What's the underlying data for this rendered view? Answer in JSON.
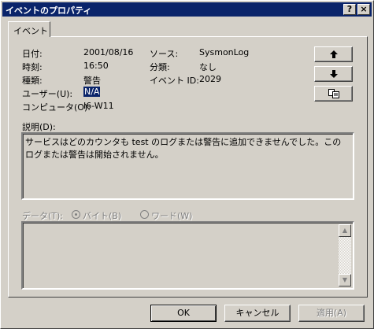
{
  "window": {
    "title": "イベントのプロパティ",
    "help_label": "?",
    "close_label": "×"
  },
  "tab": {
    "label": "イベント"
  },
  "fields": {
    "date_label": "日付:",
    "date": "2001/08/16",
    "time_label": "時刻:",
    "time": "16:50",
    "type_label": "種類:",
    "type": "警告",
    "user_label": "ユーザー(U):",
    "user": "N/A",
    "computer_label": "コンピュータ(O):",
    "computer": "I6-W11",
    "source_label": "ソース:",
    "source": "SysmonLog",
    "category_label": "分類:",
    "category": "なし",
    "event_id_label": "イベント ID:",
    "event_id": "2029"
  },
  "nav": {
    "up_icon": "↑",
    "down_icon": "↓",
    "copy_icon": "copy"
  },
  "description": {
    "label": "説明(D):",
    "text": "サービスはどのカウンタも test のログまたは警告に追加できませんでした。このログまたは警告は開始されません。"
  },
  "data_section": {
    "label": "データ(T):",
    "byte_label": "バイト(B)",
    "word_label": "ワード(W)",
    "selected": "byte"
  },
  "buttons": {
    "ok": "OK",
    "cancel": "キャンセル",
    "apply": "適用(A)"
  }
}
